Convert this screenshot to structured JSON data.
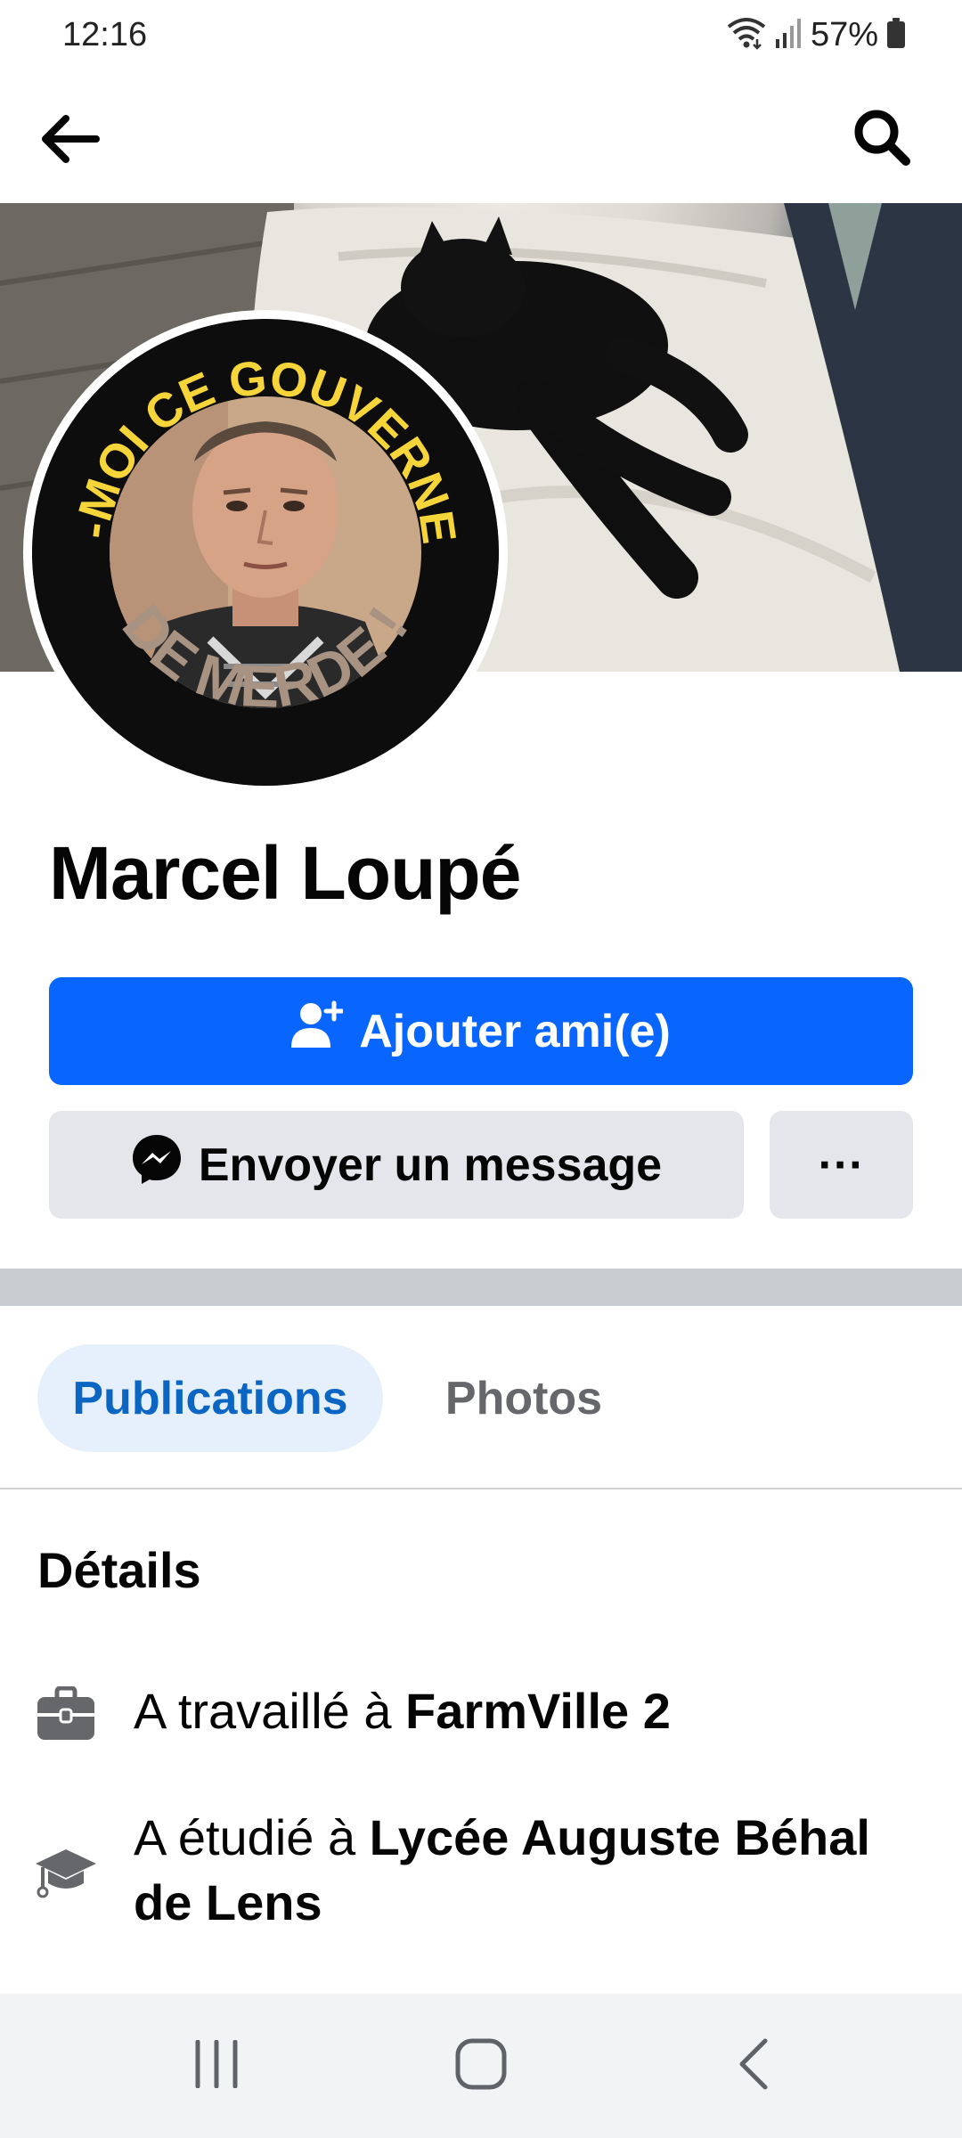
{
  "status_bar": {
    "time": "12:16",
    "battery": "57%",
    "icons": [
      "wifi-icon",
      "signal-icon",
      "battery-icon"
    ]
  },
  "app_bar": {
    "back_icon": "arrow-left-icon",
    "search_icon": "search-icon"
  },
  "profile": {
    "name": "Marcel Loupé",
    "avatar_text_top": "VIREZ-MOI CE GOUVERNEMENT",
    "avatar_text_bottom": "DE MERDE !"
  },
  "actions": {
    "add_friend_label": "Ajouter ami(e)",
    "add_friend_icon": "add-person-icon",
    "message_label": "Envoyer un message",
    "message_icon": "messenger-icon",
    "more_label": "···"
  },
  "tabs": [
    {
      "label": "Publications",
      "active": true
    },
    {
      "label": "Photos",
      "active": false
    }
  ],
  "details": {
    "title": "Détails",
    "items": [
      {
        "icon": "briefcase-icon",
        "prefix": "A travaillé à ",
        "value": "FarmVille 2"
      },
      {
        "icon": "graduation-cap-icon",
        "prefix": "A étudié à ",
        "value": "Lycée Auguste Béhal de Lens"
      }
    ]
  },
  "colors": {
    "primary": "#0866ff",
    "tab_active_bg": "#e6f0fc",
    "tab_active_text": "#0a66c2",
    "secondary_bg": "#e4e6eb",
    "divider": "#c9ccd1"
  },
  "nav_bar": {
    "buttons": [
      "recent-apps-icon",
      "home-icon",
      "back-icon"
    ]
  }
}
